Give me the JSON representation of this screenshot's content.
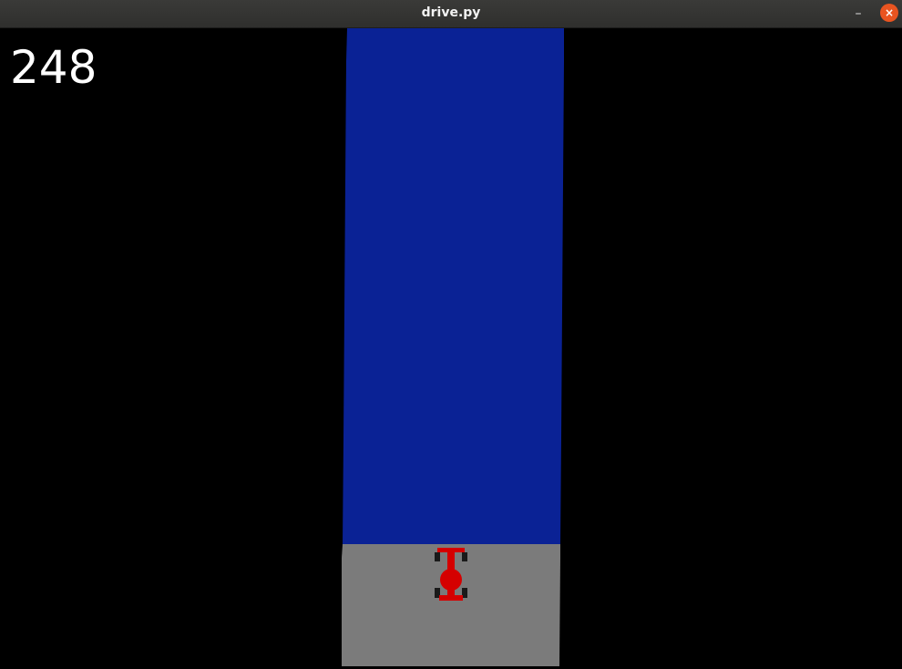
{
  "window": {
    "title": "drive.py",
    "minimize_glyph": "–",
    "close_glyph": "×"
  },
  "hud": {
    "score": "248"
  },
  "colors": {
    "background": "#000000",
    "water": "#0a2295",
    "road": "#7b7b7b",
    "car_body": "#d50000",
    "car_tire": "#1a1a1a"
  }
}
